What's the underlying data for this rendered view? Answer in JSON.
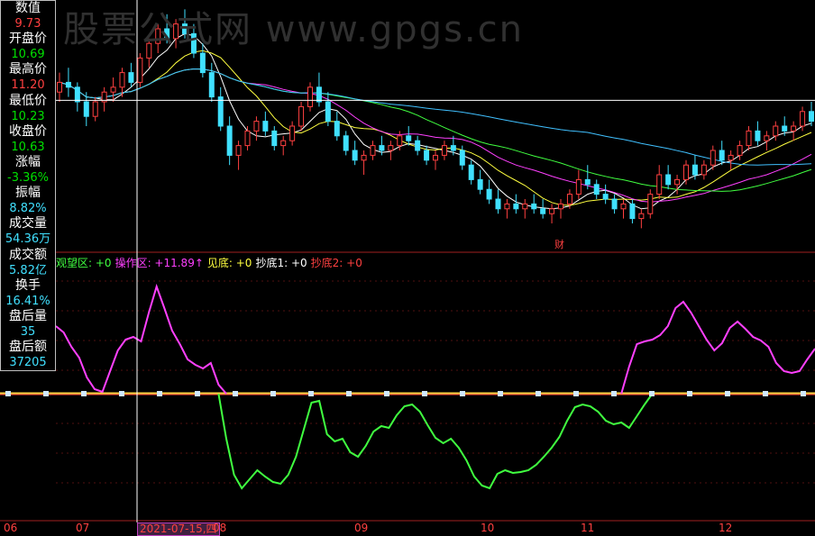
{
  "watermark": "股票公式网 www.gpgs.cn",
  "info_panel": [
    {
      "label": "数值",
      "value": "9.73",
      "cls": "v-up"
    },
    {
      "label": "开盘价",
      "value": "10.69",
      "cls": "v-dn"
    },
    {
      "label": "最高价",
      "value": "11.20",
      "cls": "v-up"
    },
    {
      "label": "最低价",
      "value": "10.23",
      "cls": "v-dn"
    },
    {
      "label": "收盘价",
      "value": "10.63",
      "cls": "v-dn"
    },
    {
      "label": "涨幅",
      "value": "-3.36%",
      "cls": "v-dn"
    },
    {
      "label": "振幅",
      "value": "8.82%",
      "cls": "v-cy"
    },
    {
      "label": "成交量",
      "value": "54.36万",
      "cls": "v-cy"
    },
    {
      "label": "成交额",
      "value": "5.82亿",
      "cls": "v-cy"
    },
    {
      "label": "换手",
      "value": "16.41%",
      "cls": "v-cy"
    },
    {
      "label": "盘后量",
      "value": "35",
      "cls": "v-cy"
    },
    {
      "label": "盘后额",
      "value": "37205",
      "cls": "v-cy"
    }
  ],
  "legend": [
    {
      "text": "观望区: +0",
      "color": "#40ff40"
    },
    {
      "text": "操作区: +11.89↑",
      "color": "#ff40ff"
    },
    {
      "text": "见底: +0",
      "color": "#ffff40"
    },
    {
      "text": "抄底1: +0",
      "color": "#ffffff"
    },
    {
      "text": "抄底2: +0",
      "color": "#ff4040"
    }
  ],
  "event_marker": "财",
  "cursor_date": "2021-07-15,四",
  "chart_data": [
    {
      "type": "candlestick",
      "x_axis_labels": [
        "06",
        "07",
        "08",
        "09",
        "10",
        "11",
        "12"
      ],
      "horizontal_line": 10.63,
      "ohlc": [
        [
          10.8,
          11.2,
          10.6,
          11.0
        ],
        [
          11.0,
          11.3,
          10.7,
          10.9
        ],
        [
          10.9,
          11.0,
          10.4,
          10.6
        ],
        [
          10.6,
          10.8,
          10.1,
          10.3
        ],
        [
          10.3,
          10.7,
          10.2,
          10.6
        ],
        [
          10.6,
          10.9,
          10.4,
          10.8
        ],
        [
          10.8,
          11.1,
          10.6,
          10.9
        ],
        [
          10.9,
          11.3,
          10.7,
          11.2
        ],
        [
          11.2,
          11.4,
          10.9,
          11.0
        ],
        [
          11.0,
          11.6,
          10.9,
          11.5
        ],
        [
          11.5,
          11.9,
          11.3,
          11.8
        ],
        [
          11.8,
          12.2,
          11.6,
          12.1
        ],
        [
          12.1,
          12.4,
          11.8,
          11.9
        ],
        [
          11.9,
          12.3,
          11.7,
          12.2
        ],
        [
          12.2,
          12.5,
          11.9,
          12.0
        ],
        [
          12.0,
          12.2,
          11.5,
          11.6
        ],
        [
          11.6,
          11.8,
          11.1,
          11.2
        ],
        [
          11.2,
          11.4,
          10.6,
          10.7
        ],
        [
          10.7,
          10.9,
          10.0,
          10.1
        ],
        [
          10.1,
          10.3,
          9.3,
          9.5
        ],
        [
          9.5,
          9.8,
          9.2,
          9.7
        ],
        [
          9.7,
          10.1,
          9.6,
          10.0
        ],
        [
          10.0,
          10.3,
          9.8,
          10.2
        ],
        [
          10.2,
          10.4,
          9.9,
          10.0
        ],
        [
          10.0,
          10.1,
          9.6,
          9.7
        ],
        [
          9.7,
          9.9,
          9.5,
          9.8
        ],
        [
          9.8,
          10.2,
          9.7,
          10.1
        ],
        [
          10.1,
          10.6,
          10.0,
          10.5
        ],
        [
          10.5,
          11.0,
          10.4,
          10.9
        ],
        [
          10.9,
          11.2,
          10.5,
          10.6
        ],
        [
          10.6,
          10.8,
          10.1,
          10.2
        ],
        [
          10.2,
          10.4,
          9.8,
          9.9
        ],
        [
          9.9,
          10.0,
          9.5,
          9.6
        ],
        [
          9.6,
          9.8,
          9.3,
          9.4
        ],
        [
          9.4,
          9.6,
          9.1,
          9.5
        ],
        [
          9.5,
          9.8,
          9.4,
          9.7
        ],
        [
          9.7,
          9.9,
          9.5,
          9.6
        ],
        [
          9.6,
          9.8,
          9.4,
          9.7
        ],
        [
          9.7,
          10.0,
          9.6,
          9.9
        ],
        [
          9.9,
          10.1,
          9.7,
          9.8
        ],
        [
          9.8,
          9.9,
          9.5,
          9.6
        ],
        [
          9.6,
          9.7,
          9.3,
          9.4
        ],
        [
          9.4,
          9.6,
          9.2,
          9.5
        ],
        [
          9.5,
          9.8,
          9.4,
          9.7
        ],
        [
          9.7,
          9.9,
          9.5,
          9.6
        ],
        [
          9.6,
          9.7,
          9.2,
          9.3
        ],
        [
          9.3,
          9.4,
          8.9,
          9.0
        ],
        [
          9.0,
          9.2,
          8.7,
          8.8
        ],
        [
          8.8,
          9.0,
          8.5,
          8.6
        ],
        [
          8.6,
          8.8,
          8.3,
          8.4
        ],
        [
          8.4,
          8.6,
          8.2,
          8.5
        ],
        [
          8.5,
          8.7,
          8.3,
          8.4
        ],
        [
          8.4,
          8.6,
          8.2,
          8.5
        ],
        [
          8.5,
          8.7,
          8.3,
          8.4
        ],
        [
          8.4,
          8.6,
          8.2,
          8.3
        ],
        [
          8.3,
          8.5,
          8.1,
          8.4
        ],
        [
          8.4,
          8.6,
          8.2,
          8.5
        ],
        [
          8.5,
          8.8,
          8.4,
          8.7
        ],
        [
          8.7,
          9.2,
          8.6,
          9.0
        ],
        [
          9.0,
          9.3,
          8.8,
          8.9
        ],
        [
          8.9,
          9.0,
          8.6,
          8.7
        ],
        [
          8.7,
          8.9,
          8.5,
          8.6
        ],
        [
          8.6,
          8.7,
          8.3,
          8.4
        ],
        [
          8.4,
          8.6,
          8.2,
          8.5
        ],
        [
          8.5,
          8.6,
          8.1,
          8.2
        ],
        [
          8.2,
          8.4,
          8.0,
          8.3
        ],
        [
          8.3,
          8.8,
          8.2,
          8.7
        ],
        [
          8.7,
          9.3,
          8.6,
          9.1
        ],
        [
          9.1,
          9.3,
          8.8,
          8.9
        ],
        [
          8.9,
          9.1,
          8.7,
          9.0
        ],
        [
          9.0,
          9.4,
          8.9,
          9.3
        ],
        [
          9.3,
          9.5,
          9.0,
          9.1
        ],
        [
          9.1,
          9.4,
          9.0,
          9.3
        ],
        [
          9.3,
          9.7,
          9.2,
          9.6
        ],
        [
          9.6,
          9.8,
          9.3,
          9.4
        ],
        [
          9.4,
          9.6,
          9.2,
          9.5
        ],
        [
          9.5,
          9.8,
          9.4,
          9.7
        ],
        [
          9.7,
          10.1,
          9.6,
          10.0
        ],
        [
          10.0,
          10.2,
          9.7,
          9.8
        ],
        [
          9.8,
          10.0,
          9.6,
          9.9
        ],
        [
          9.9,
          10.2,
          9.8,
          10.1
        ],
        [
          10.1,
          10.3,
          9.9,
          10.0
        ],
        [
          10.0,
          10.2,
          9.8,
          10.1
        ],
        [
          10.1,
          10.5,
          10.0,
          10.4
        ],
        [
          10.4,
          10.6,
          10.1,
          10.2
        ]
      ]
    },
    {
      "type": "line",
      "series": [
        {
          "color": "#ff40ff",
          "values": [
            7.5,
            6.8,
            5.2,
            4.0,
            1.8,
            0.5,
            0.2,
            2.5,
            4.8,
            6.0,
            6.3,
            5.8,
            9.0,
            11.89,
            9.5,
            7.0,
            5.5,
            3.8,
            3.2,
            2.8,
            3.4,
            1.0,
            0,
            0,
            0,
            0,
            0,
            0,
            0,
            0,
            0,
            0,
            0,
            0,
            0,
            0,
            0,
            0,
            0,
            0,
            0,
            0,
            0,
            0,
            0,
            0,
            0,
            0,
            0,
            0,
            0,
            0,
            0,
            0,
            0,
            0,
            0,
            0,
            0,
            0,
            0,
            0,
            0,
            0,
            0,
            0,
            0,
            0,
            0,
            0,
            0,
            0,
            0,
            0,
            3.0,
            5.5,
            5.8,
            6.0,
            6.5,
            7.5,
            9.5,
            10.2,
            9.0,
            7.5,
            6.0,
            4.8,
            5.6,
            7.3,
            8.0,
            7.2,
            6.3,
            5.9,
            5.2,
            3.4,
            2.5,
            2.3,
            2.5,
            3.8,
            5.0
          ]
        },
        {
          "color": "#40ff40",
          "values": [
            0,
            0,
            0,
            0,
            0,
            0,
            0,
            0,
            0,
            0,
            0,
            0,
            0,
            0,
            0,
            0,
            0,
            0,
            0,
            0,
            0,
            0,
            -5.0,
            -9.0,
            -10.5,
            -9.5,
            -8.5,
            -9.2,
            -9.8,
            -10.0,
            -9.0,
            -7.0,
            -4.0,
            -1.0,
            -0.8,
            -4.5,
            -5.3,
            -5.0,
            -6.5,
            -7.0,
            -5.8,
            -4.2,
            -3.6,
            -3.8,
            -2.4,
            -1.4,
            -1.2,
            -2.0,
            -3.5,
            -4.9,
            -5.5,
            -5.0,
            -6.0,
            -7.4,
            -9.2,
            -10.2,
            -10.5,
            -8.9,
            -8.5,
            -8.8,
            -8.7,
            -8.5,
            -7.9,
            -7.0,
            -6.0,
            -4.8,
            -3.0,
            -1.5,
            -1.2,
            -1.4,
            -2.0,
            -3.0,
            -3.4,
            -3.2,
            -3.8,
            -2.5,
            -1.2,
            0,
            0,
            0,
            0,
            0,
            0,
            0,
            0,
            0,
            0,
            0,
            0,
            0,
            0,
            0,
            0,
            0,
            0,
            0,
            0,
            0,
            0,
            0,
            0,
            0
          ]
        },
        {
          "color": "#ff4040",
          "values": [
            0,
            0
          ]
        }
      ]
    }
  ]
}
